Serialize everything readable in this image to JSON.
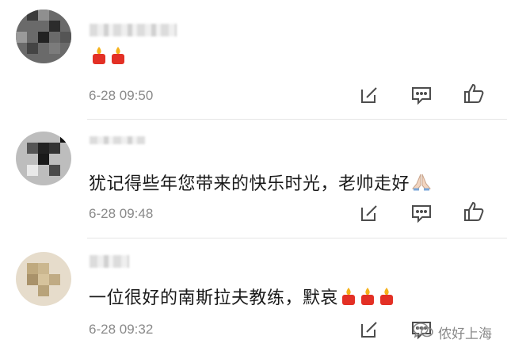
{
  "comments": [
    {
      "text": "",
      "emoji": [
        "red-candle",
        "red-candle"
      ],
      "time": "6-28 09:50"
    },
    {
      "text": "犹记得些年您带来的快乐时光，老帅走好",
      "emoji": [
        "folded-hands"
      ],
      "time": "6-28 09:48"
    },
    {
      "text": "一位很好的南斯拉夫教练，默哀",
      "emoji": [
        "red-candle",
        "red-candle",
        "red-candle"
      ],
      "time": "6-28 09:32"
    }
  ],
  "actions": {
    "icons": [
      "edit-icon",
      "comment-icon",
      "like-icon"
    ]
  },
  "watermark": {
    "text": "侬好上海"
  },
  "colors": {
    "text": "#1a1a1a",
    "time": "#8a8a8a",
    "icon": "#4d4d4d",
    "candle": "#e33025",
    "flame": "#f6b21a"
  }
}
